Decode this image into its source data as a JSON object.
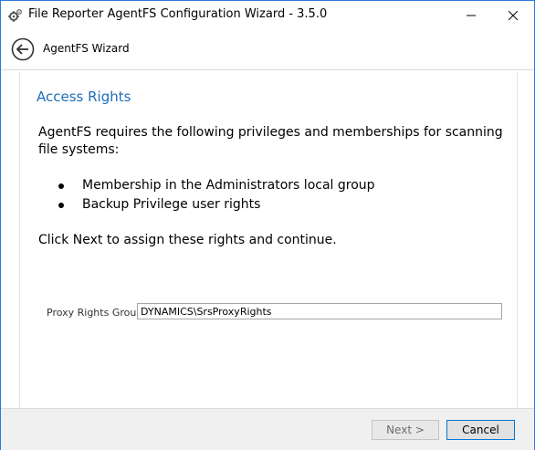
{
  "window": {
    "title": "File Reporter AgentFS Configuration Wizard - 3.5.0",
    "icon": "gears-icon"
  },
  "nav": {
    "back_icon": "back-arrow-icon",
    "title": "AgentFS Wizard"
  },
  "page": {
    "heading": "Access Rights",
    "intro": "AgentFS requires the following privileges and memberships for scanning file systems:",
    "bullets": [
      "Membership in the Administrators local group",
      "Backup Privilege user rights"
    ],
    "outro": "Click Next to assign these rights and continue."
  },
  "form": {
    "proxy_rights_group_label": "Proxy Rights Group",
    "proxy_rights_group_value": "DYNAMICS\\SrsProxyRights"
  },
  "footer": {
    "next_label": "Next >",
    "cancel_label": "Cancel"
  },
  "colors": {
    "heading": "#1e6db8",
    "window_border": "#2b79d7",
    "footer_bg": "#f0f0f0"
  }
}
